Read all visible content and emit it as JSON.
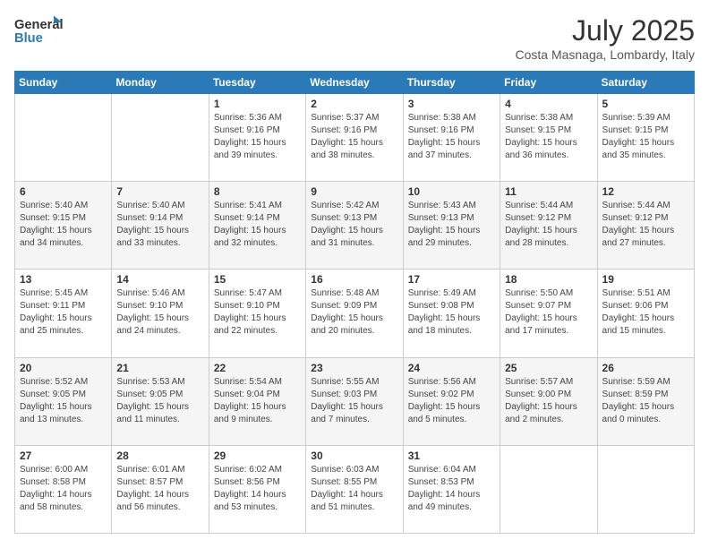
{
  "header": {
    "logo_line1": "General",
    "logo_line2": "Blue",
    "main_title": "July 2025",
    "sub_title": "Costa Masnaga, Lombardy, Italy"
  },
  "days_of_week": [
    "Sunday",
    "Monday",
    "Tuesday",
    "Wednesday",
    "Thursday",
    "Friday",
    "Saturday"
  ],
  "weeks": [
    [
      {
        "day": "",
        "info": ""
      },
      {
        "day": "",
        "info": ""
      },
      {
        "day": "1",
        "info": "Sunrise: 5:36 AM\nSunset: 9:16 PM\nDaylight: 15 hours and 39 minutes."
      },
      {
        "day": "2",
        "info": "Sunrise: 5:37 AM\nSunset: 9:16 PM\nDaylight: 15 hours and 38 minutes."
      },
      {
        "day": "3",
        "info": "Sunrise: 5:38 AM\nSunset: 9:16 PM\nDaylight: 15 hours and 37 minutes."
      },
      {
        "day": "4",
        "info": "Sunrise: 5:38 AM\nSunset: 9:15 PM\nDaylight: 15 hours and 36 minutes."
      },
      {
        "day": "5",
        "info": "Sunrise: 5:39 AM\nSunset: 9:15 PM\nDaylight: 15 hours and 35 minutes."
      }
    ],
    [
      {
        "day": "6",
        "info": "Sunrise: 5:40 AM\nSunset: 9:15 PM\nDaylight: 15 hours and 34 minutes."
      },
      {
        "day": "7",
        "info": "Sunrise: 5:40 AM\nSunset: 9:14 PM\nDaylight: 15 hours and 33 minutes."
      },
      {
        "day": "8",
        "info": "Sunrise: 5:41 AM\nSunset: 9:14 PM\nDaylight: 15 hours and 32 minutes."
      },
      {
        "day": "9",
        "info": "Sunrise: 5:42 AM\nSunset: 9:13 PM\nDaylight: 15 hours and 31 minutes."
      },
      {
        "day": "10",
        "info": "Sunrise: 5:43 AM\nSunset: 9:13 PM\nDaylight: 15 hours and 29 minutes."
      },
      {
        "day": "11",
        "info": "Sunrise: 5:44 AM\nSunset: 9:12 PM\nDaylight: 15 hours and 28 minutes."
      },
      {
        "day": "12",
        "info": "Sunrise: 5:44 AM\nSunset: 9:12 PM\nDaylight: 15 hours and 27 minutes."
      }
    ],
    [
      {
        "day": "13",
        "info": "Sunrise: 5:45 AM\nSunset: 9:11 PM\nDaylight: 15 hours and 25 minutes."
      },
      {
        "day": "14",
        "info": "Sunrise: 5:46 AM\nSunset: 9:10 PM\nDaylight: 15 hours and 24 minutes."
      },
      {
        "day": "15",
        "info": "Sunrise: 5:47 AM\nSunset: 9:10 PM\nDaylight: 15 hours and 22 minutes."
      },
      {
        "day": "16",
        "info": "Sunrise: 5:48 AM\nSunset: 9:09 PM\nDaylight: 15 hours and 20 minutes."
      },
      {
        "day": "17",
        "info": "Sunrise: 5:49 AM\nSunset: 9:08 PM\nDaylight: 15 hours and 18 minutes."
      },
      {
        "day": "18",
        "info": "Sunrise: 5:50 AM\nSunset: 9:07 PM\nDaylight: 15 hours and 17 minutes."
      },
      {
        "day": "19",
        "info": "Sunrise: 5:51 AM\nSunset: 9:06 PM\nDaylight: 15 hours and 15 minutes."
      }
    ],
    [
      {
        "day": "20",
        "info": "Sunrise: 5:52 AM\nSunset: 9:05 PM\nDaylight: 15 hours and 13 minutes."
      },
      {
        "day": "21",
        "info": "Sunrise: 5:53 AM\nSunset: 9:05 PM\nDaylight: 15 hours and 11 minutes."
      },
      {
        "day": "22",
        "info": "Sunrise: 5:54 AM\nSunset: 9:04 PM\nDaylight: 15 hours and 9 minutes."
      },
      {
        "day": "23",
        "info": "Sunrise: 5:55 AM\nSunset: 9:03 PM\nDaylight: 15 hours and 7 minutes."
      },
      {
        "day": "24",
        "info": "Sunrise: 5:56 AM\nSunset: 9:02 PM\nDaylight: 15 hours and 5 minutes."
      },
      {
        "day": "25",
        "info": "Sunrise: 5:57 AM\nSunset: 9:00 PM\nDaylight: 15 hours and 2 minutes."
      },
      {
        "day": "26",
        "info": "Sunrise: 5:59 AM\nSunset: 8:59 PM\nDaylight: 15 hours and 0 minutes."
      }
    ],
    [
      {
        "day": "27",
        "info": "Sunrise: 6:00 AM\nSunset: 8:58 PM\nDaylight: 14 hours and 58 minutes."
      },
      {
        "day": "28",
        "info": "Sunrise: 6:01 AM\nSunset: 8:57 PM\nDaylight: 14 hours and 56 minutes."
      },
      {
        "day": "29",
        "info": "Sunrise: 6:02 AM\nSunset: 8:56 PM\nDaylight: 14 hours and 53 minutes."
      },
      {
        "day": "30",
        "info": "Sunrise: 6:03 AM\nSunset: 8:55 PM\nDaylight: 14 hours and 51 minutes."
      },
      {
        "day": "31",
        "info": "Sunrise: 6:04 AM\nSunset: 8:53 PM\nDaylight: 14 hours and 49 minutes."
      },
      {
        "day": "",
        "info": ""
      },
      {
        "day": "",
        "info": ""
      }
    ]
  ]
}
